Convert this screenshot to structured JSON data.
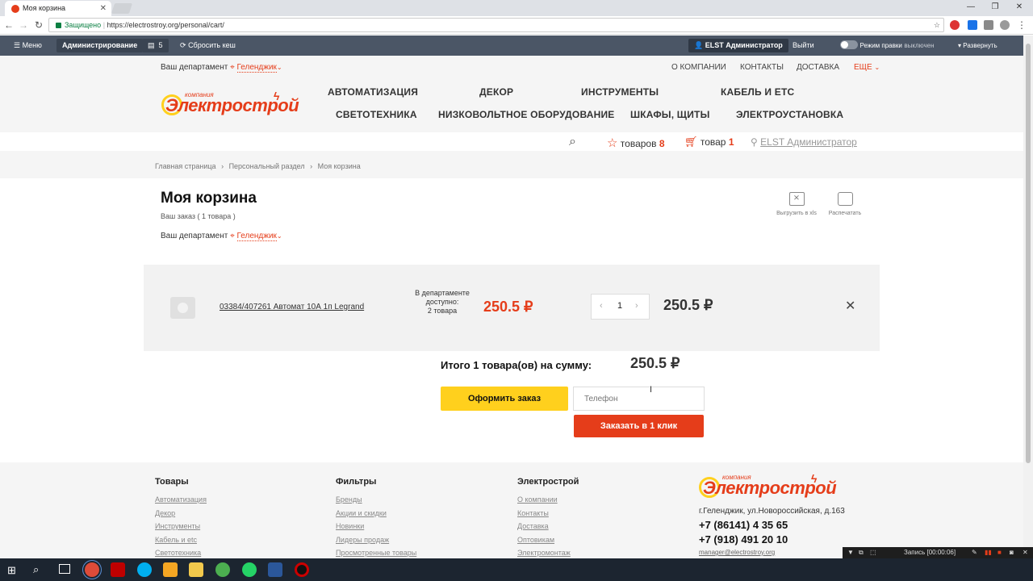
{
  "browser": {
    "tab_title": "Моя корзина",
    "secure_label": "Защищено",
    "url": "https://electrostroy.org/personal/cart/"
  },
  "admin_panel": {
    "menu": "Меню",
    "administration": "Администрирование",
    "badge_count": "5",
    "clear_cache": "Сбросить кеш",
    "user": "ELST Администратор",
    "logout": "Выйти",
    "edit_mode": "Режим правки",
    "edit_mode_state": "выключен",
    "expand": "Развернуть"
  },
  "header": {
    "department_label": "Ваш департамент",
    "department_value": "Геленджик",
    "top_links": [
      "О КОМПАНИИ",
      "КОНТАКТЫ",
      "ДОСТАВКА",
      "ЕЩЕ"
    ],
    "logo_small": "компания",
    "logo_main": "Электрострой",
    "menu_row1": [
      "АВТОМАТИЗАЦИЯ",
      "ДЕКОР",
      "ИНСТРУМЕНТЫ",
      "КАБЕЛЬ И ЕТС"
    ],
    "menu_row2": [
      "СВЕТОТЕХНИКА",
      "НИЗКОВОЛЬТНОЕ ОБОРУДОВАНИЕ",
      "ШКАФЫ, ЩИТЫ",
      "ЭЛЕКТРОУСТАНОВКА"
    ],
    "favorites_label": "товаров",
    "favorites_count": "8",
    "cart_label": "товар",
    "cart_count": "1",
    "user_link": "ELST Администратор"
  },
  "breadcrumbs": [
    "Главная страница",
    "Персональный раздел",
    "Моя корзина"
  ],
  "cart": {
    "title": "Моя корзина",
    "subtitle": "Ваш заказ ( 1 товара )",
    "department_label": "Ваш департамент",
    "department_value": "Геленджик",
    "export_label": "Выгрузить в xls",
    "print_label": "Распечатать",
    "item": {
      "name": "03384/407261 Автомат 10А 1п Legrand",
      "availability_line1": "В департаменте",
      "availability_line2": "доступно:",
      "availability_line3": "2 товара",
      "price": "250.5 ₽",
      "quantity": "1",
      "total": "250.5 ₽"
    },
    "summary_label": "Итого 1 товара(ов) на сумму:",
    "summary_value": "250.5 ₽",
    "checkout_button": "Оформить заказ",
    "phone_placeholder": "Телефон",
    "one_click_button": "Заказать в 1 клик"
  },
  "footer": {
    "col1_title": "Товары",
    "col1_links": [
      "Автоматизация",
      "Декор",
      "Инструменты",
      "Кабель и etc",
      "Светотехника"
    ],
    "col2_title": "Фильтры",
    "col2_links": [
      "Бренды",
      "Акции и скидки",
      "Новинки",
      "Лидеры продаж",
      "Просмотренные товары"
    ],
    "col3_title": "Электрострой",
    "col3_links": [
      "О компании",
      "Контакты",
      "Доставка",
      "Оптовикам",
      "Электромонтаж"
    ],
    "address": "г.Геленджик, ул.Новороссийская, д.163",
    "phone1": "+7 (86141) 4 35 65",
    "phone2": "+7 (918) 491 20 10",
    "email": "manager@electrostroy.org"
  },
  "recorder": {
    "label": "Запись [00:00:06]"
  },
  "colors": {
    "accent_red": "#e53d1a",
    "accent_yellow": "#ffd01d",
    "admin_bar": "#4b5666"
  }
}
